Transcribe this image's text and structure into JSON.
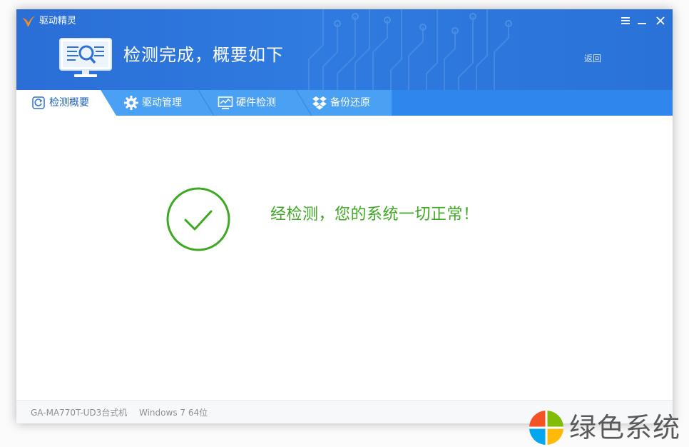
{
  "app": {
    "name": "驱动精灵",
    "header_title": "检测完成，概要如下",
    "back_label": "返回"
  },
  "window_controls": {
    "menu_icon": "hamburger-menu-icon",
    "minimize_icon": "minimize-icon",
    "close_icon": "close-icon"
  },
  "tabs": [
    {
      "label": "检测概要",
      "icon": "refresh-icon",
      "active": true
    },
    {
      "label": "驱动管理",
      "icon": "gear-icon",
      "active": false
    },
    {
      "label": "硬件检测",
      "icon": "monitor-chart-icon",
      "active": false
    },
    {
      "label": "备份还原",
      "icon": "dropbox-icon",
      "active": false
    }
  ],
  "result": {
    "icon": "check-circle-icon",
    "message": "经检测，您的系统一切正常！"
  },
  "status": {
    "model": "GA-MA770T-UD3台式机",
    "os": "Windows 7 64位"
  },
  "watermark": {
    "text": "绿色系统",
    "icon": "colorful-windows-logo-icon"
  },
  "colors": {
    "header_blue": "#2a6ed6",
    "tabbar_blue": "#2f86ec",
    "active_tab_text": "#1d5fb8",
    "success_green": "#3da821",
    "status_text": "#8a8f96"
  }
}
